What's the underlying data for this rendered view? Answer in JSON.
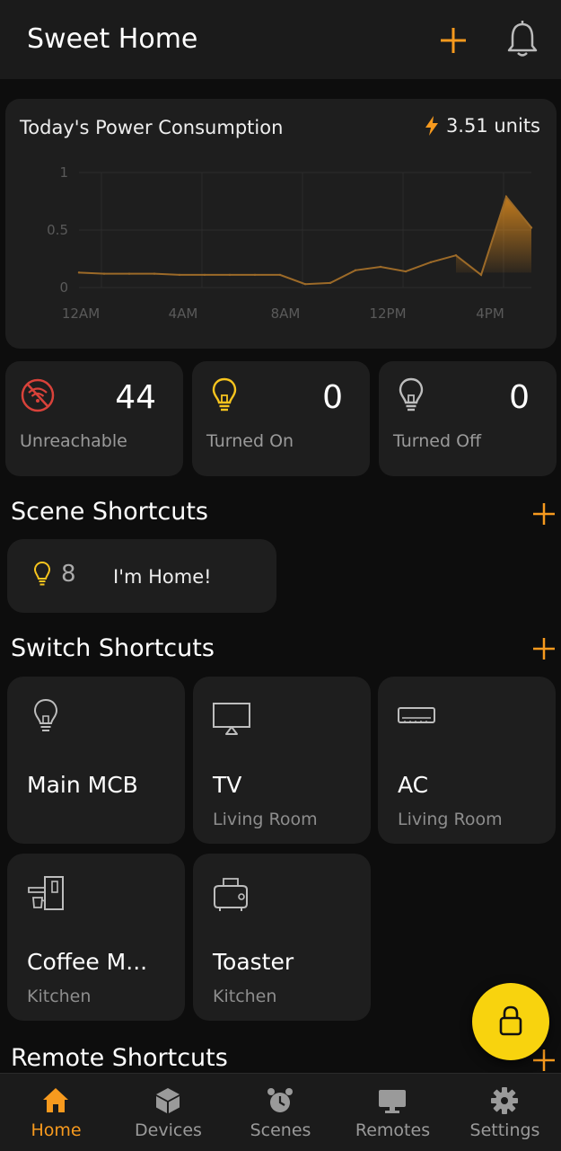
{
  "header": {
    "title": "Sweet Home",
    "add_icon": "plus-icon",
    "bell_icon": "bell-icon"
  },
  "power": {
    "title": "Today's Power Consumption",
    "value": "3.51 units",
    "icon": "bolt-icon",
    "accent_color": "#f79a1e"
  },
  "chart_data": {
    "type": "area",
    "x_ticks": [
      "12AM",
      "4AM",
      "8AM",
      "12PM",
      "4PM"
    ],
    "y_ticks": [
      "1",
      "0.5",
      "0"
    ],
    "ylim": [
      0,
      1
    ],
    "xlim": [
      0,
      18
    ],
    "grid": true,
    "points": [
      [
        0,
        0.13
      ],
      [
        1,
        0.12
      ],
      [
        2,
        0.12
      ],
      [
        3,
        0.12
      ],
      [
        4,
        0.11
      ],
      [
        5,
        0.11
      ],
      [
        6,
        0.11
      ],
      [
        7,
        0.11
      ],
      [
        8,
        0.11
      ],
      [
        9,
        0.03
      ],
      [
        10,
        0.04
      ],
      [
        11,
        0.15
      ],
      [
        12,
        0.18
      ],
      [
        13,
        0.14
      ],
      [
        14,
        0.22
      ],
      [
        15,
        0.28
      ],
      [
        16,
        0.11
      ],
      [
        17,
        0.79
      ],
      [
        18,
        0.52
      ]
    ]
  },
  "stats": [
    {
      "value": "44",
      "label": "Unreachable",
      "icon": "wifi-off-icon"
    },
    {
      "value": "0",
      "label": "Turned On",
      "icon": "bulb-on-icon"
    },
    {
      "value": "0",
      "label": "Turned Off",
      "icon": "bulb-off-icon"
    }
  ],
  "scenes": {
    "title": "Scene Shortcuts",
    "items": [
      {
        "count": "8",
        "name": "I'm Home!",
        "icon": "bulb-icon"
      }
    ]
  },
  "switches": {
    "title": "Switch Shortcuts",
    "items": [
      {
        "name": "Main MCB",
        "room": "",
        "icon": "bulb-icon"
      },
      {
        "name": "TV",
        "room": "Living Room",
        "icon": "tv-icon"
      },
      {
        "name": "AC",
        "room": "Living Room",
        "icon": "ac-icon"
      },
      {
        "name": "Coffee M...",
        "room": "Kitchen",
        "icon": "coffee-machine-icon"
      },
      {
        "name": "Toaster",
        "room": "Kitchen",
        "icon": "toaster-icon"
      }
    ]
  },
  "remotes": {
    "title": "Remote Shortcuts"
  },
  "fab": {
    "icon": "lock-icon",
    "color": "#f8d30e"
  },
  "nav": {
    "items": [
      {
        "label": "Home",
        "icon": "home-icon",
        "active": true
      },
      {
        "label": "Devices",
        "icon": "cube-icon",
        "active": false
      },
      {
        "label": "Scenes",
        "icon": "alarm-clock-icon",
        "active": false
      },
      {
        "label": "Remotes",
        "icon": "monitor-icon",
        "active": false
      },
      {
        "label": "Settings",
        "icon": "gear-icon",
        "active": false
      }
    ]
  }
}
